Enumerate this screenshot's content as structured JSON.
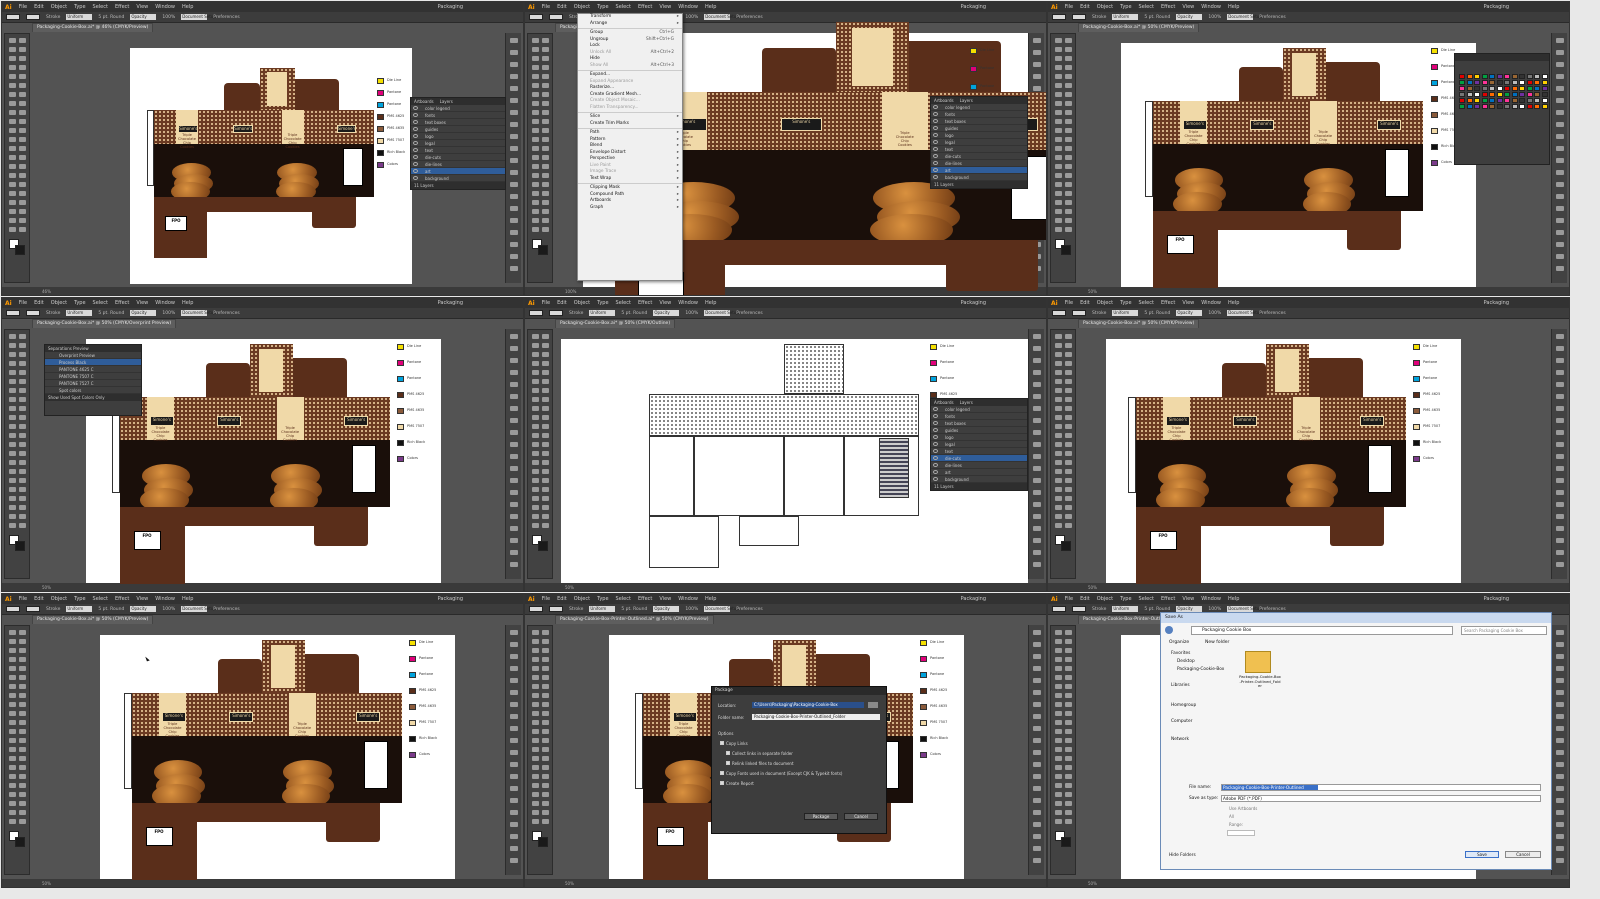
{
  "app": {
    "menu": [
      "File",
      "Edit",
      "Object",
      "Type",
      "Select",
      "Effect",
      "View",
      "Window",
      "Help"
    ],
    "workspace": "Packaging",
    "control_bar": [
      "Stroke",
      "Uniform",
      "5 pt. Round",
      "Opacity",
      "100%",
      "Document Setup",
      "Preferences"
    ],
    "accent": "#ff9a00"
  },
  "panels": [
    {
      "tab": "Packaging-Cookie-Box.ai* @ 46% (CMYK/Preview)",
      "zoom": "46%"
    },
    {
      "tab": "Packaging-Cookie-Box.ai* @ 100% (CMYK/Preview)",
      "zoom": "100%"
    },
    {
      "tab": "Packaging-Cookie-Box.ai* @ 50% (CMYK/Preview)",
      "zoom": "50%"
    },
    {
      "tab": "Packaging-Cookie-Box.ai* @ 50% (CMYK/Overprint Preview)",
      "zoom": "50%"
    },
    {
      "tab": "Packaging-Cookie-Box.ai* @ 50% (CMYK/Outline)",
      "zoom": "50%"
    },
    {
      "tab": "Packaging-Cookie-Box.ai* @ 50% (CMYK/Preview)",
      "zoom": "50%"
    },
    {
      "tab": "Packaging-Cookie-Box.ai* @ 50% (CMYK/Preview)",
      "zoom": "50%"
    },
    {
      "tab": "Packaging-Cookie-Box-Printer-Outlined.ai* @ 50% (CMYK/Preview)",
      "zoom": "50%"
    },
    {
      "tab": "Packaging-Cookie-Box-Printer-Outlined.ai @ 50% (CMYK/Preview)",
      "zoom": "50%"
    }
  ],
  "box_text": {
    "brand": "Simone's",
    "product_lines": [
      "Triple",
      "Chocolate",
      "Chip"
    ],
    "product_title": "Cookies",
    "net_wt": "NET WT. 7 OZ (198g)",
    "fpo": "FPO"
  },
  "swatch_labels": [
    "Die Line",
    "Pantone",
    "Pantone",
    "PMS 4625",
    "PMS 4635",
    "PMS 7507",
    "Rich Black",
    "Colors"
  ],
  "swatch_colors": [
    "#f5e000",
    "#e0007a",
    "#00a3dd",
    "#5a2e1a",
    "#8a5a3a",
    "#f0d9a8",
    "#111111",
    "#7a3a8a"
  ],
  "layers_panel": {
    "title": "Layers",
    "tab2": "Artboards",
    "layers": [
      "color legend",
      "fonts",
      "text boxes",
      "guides",
      "logo",
      "legal",
      "text",
      "die-cuts",
      "die-lines",
      "art",
      "background"
    ],
    "footer": "11 Layers"
  },
  "object_menu": {
    "items": [
      "Transform",
      "Arrange",
      "",
      "Group",
      "Ungroup",
      "Lock",
      "Unlock All",
      "Hide",
      "Show All",
      "",
      "Expand...",
      "Expand Appearance",
      "Rasterize...",
      "Create Gradient Mesh...",
      "Create Object Mosaic...",
      "Flatten Transparency...",
      "",
      "Slice",
      "Create Trim Marks",
      "",
      "Path",
      "Pattern",
      "Blend",
      "Envelope Distort",
      "Perspective",
      "Live Paint",
      "Image Trace",
      "Text Wrap",
      "",
      "Clipping Mask",
      "Compound Path",
      "Artboards",
      "Graph"
    ],
    "shortcuts": {
      "Group": "Ctrl+G",
      "Ungroup": "Shift+Ctrl+G",
      "Unlock All": "Alt+Ctrl+2",
      "Show All": "Alt+Ctrl+3"
    }
  },
  "separations_panel": {
    "title": "Separations Preview",
    "rows": [
      "Overprint Preview",
      "Process Black",
      "PANTONE 4625 C",
      "PANTONE 7507 C",
      "PANTONE 7527 C",
      "Spot colors"
    ],
    "footer": "Show Used Spot Colors Only"
  },
  "package_dialog": {
    "title": "Package",
    "location_label": "Location:",
    "location_value": "C:\\Users\\Packaging\\Packaging-Cookie-Box",
    "folder_label": "Folder name:",
    "folder_value": "Packaging-Cookie-Box-Printer-Outlined_Folder",
    "options_label": "Options",
    "options": [
      "Copy Links",
      "Collect links in separate folder",
      "Relink linked files to document",
      "Copy Fonts used in document (Except CJK & Typekit fonts)",
      "Create Report"
    ],
    "package_button": "Package",
    "cancel_button": "Cancel"
  },
  "save_dialog": {
    "title": "Save As",
    "path": "Packaging Cookie Box",
    "search_placeholder": "Search Packaging Cookie Box",
    "organize": "Organize",
    "new_folder": "New folder",
    "nav": [
      "Favorites",
      "Desktop",
      "Packaging-Cookie-Box",
      "Libraries",
      "Homegroup",
      "Computer",
      "Network"
    ],
    "folder_item": "Packaging-Cookie-Box-Printer-Outlined_Folder",
    "filename_label": "File name:",
    "filename_value": "Packaging-Cookie-Box-Printer-Outlined",
    "type_label": "Save as type:",
    "type_value": "Adobe PDF (*.PDF)",
    "use_artboards": "Use Artboards",
    "all": "All",
    "range": "Range:",
    "hide_folders": "Hide Folders",
    "save_button": "Save",
    "cancel_button": "Cancel"
  }
}
